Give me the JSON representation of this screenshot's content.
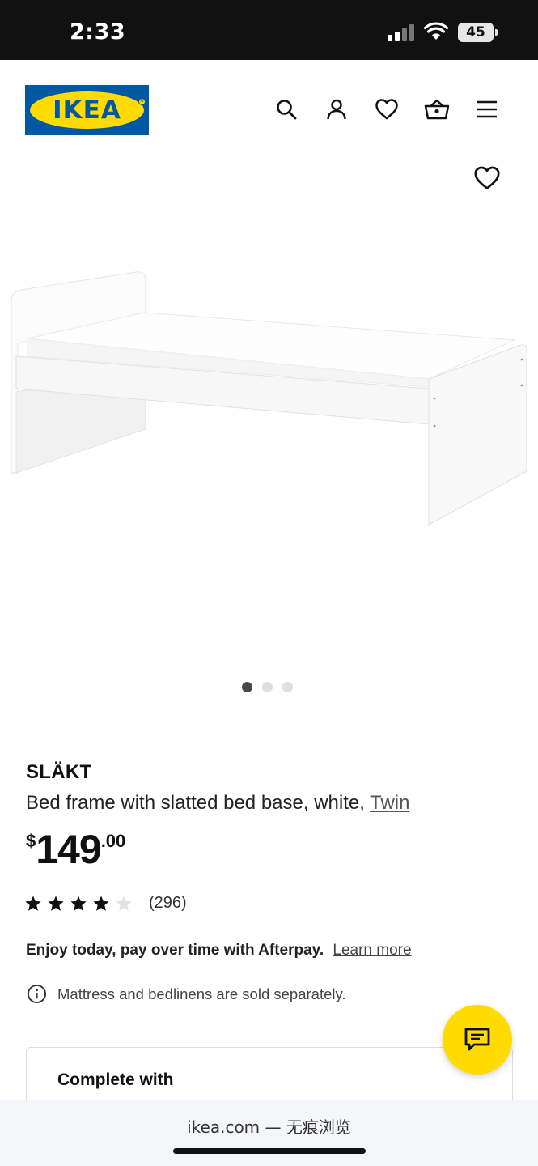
{
  "status_bar": {
    "time": "2:33",
    "battery": "45"
  },
  "header": {
    "logo_text": "IKEA",
    "icons": [
      "search-icon",
      "account-icon",
      "favorites-icon",
      "basket-icon",
      "menu-icon"
    ]
  },
  "gallery": {
    "dot_count": 3,
    "active_index": 0
  },
  "product": {
    "name": "SLÄKT",
    "description": "Bed frame with slatted bed base, white,",
    "size_link": "Twin",
    "price_currency": "$",
    "price_whole": "149",
    "price_cents": ".00",
    "rating": 4,
    "rating_max": 5,
    "review_count": "(296)"
  },
  "afterpay": {
    "text": "Enjoy today, pay over time with Afterpay.",
    "link": "Learn more"
  },
  "notice": "Mattress and bedlinens are sold separately.",
  "complete_with": {
    "title": "Complete with"
  },
  "browser": {
    "url": "ikea.com — 无痕浏览"
  },
  "colors": {
    "ikea_blue": "#0058a3",
    "ikea_yellow": "#ffdb00"
  }
}
